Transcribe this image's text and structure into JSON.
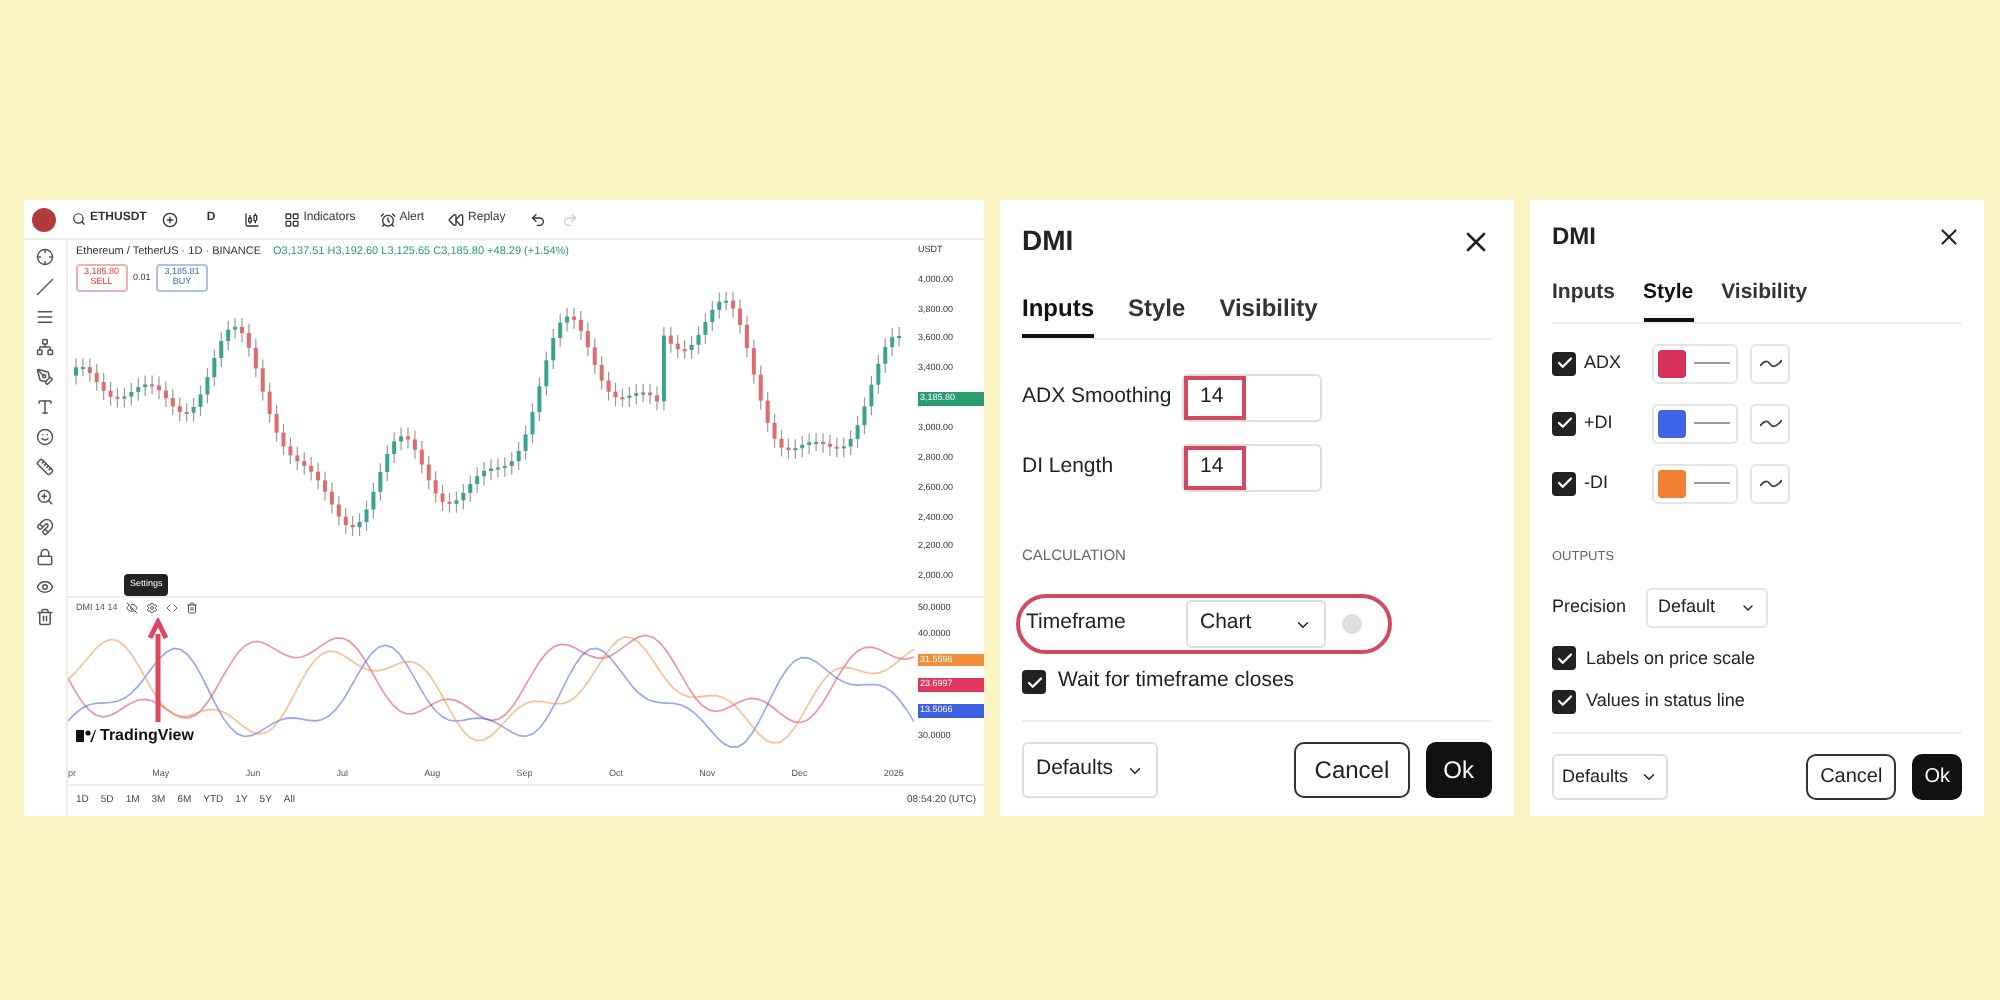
{
  "chart_window": {
    "toolbar": {
      "symbol": "ETHUSDT",
      "interval": "D",
      "items": [
        "Indicators",
        "Alert",
        "Replay"
      ]
    },
    "legend": {
      "title": "Ethereum / TetherUS · 1D · BINANCE",
      "ohlc": "O3,137.51 H3,192.60 L3,125.65 C3,185.80 +48.29 (+1.54%)"
    },
    "trade": {
      "sell_price": "3,185.80",
      "sell_label": "SELL",
      "spread": "0.01",
      "buy_price": "3,185.81",
      "buy_label": "BUY"
    },
    "currency": "USDT",
    "price_ticks": [
      "4,000.00",
      "3,800.00",
      "3,600.00",
      "3,400.00",
      "3,185.80",
      "3,000.00",
      "2,800.00",
      "2,600.00",
      "2,400.00",
      "2,200.00",
      "2,000.00"
    ],
    "indicator": {
      "label": "DMI 14 14",
      "tooltip": "Settings",
      "ticks": [
        "50.0000",
        "40.0000",
        "30.0000"
      ],
      "values": [
        {
          "text": "31.5596",
          "color": "#f28c38"
        },
        {
          "text": "23.6997",
          "color": "#e0365f"
        },
        {
          "text": "13.5066",
          "color": "#3e5fe0"
        }
      ]
    },
    "logo": "TradingView",
    "months": [
      "pr",
      "May",
      "Jun",
      "Jul",
      "Aug",
      "Sep",
      "Oct",
      "Nov",
      "Dec",
      "2025"
    ],
    "ranges": [
      "1D",
      "5D",
      "1M",
      "3M",
      "6M",
      "YTD",
      "1Y",
      "5Y",
      "All"
    ],
    "clock": "08:54:20 (UTC)"
  },
  "inputs_dialog": {
    "title": "DMI",
    "tabs": [
      {
        "label": "Inputs",
        "selected": true
      },
      {
        "label": "Style",
        "selected": false
      },
      {
        "label": "Visibility",
        "selected": false
      }
    ],
    "fields": [
      {
        "label": "ADX Smoothing",
        "value": "14",
        "highlighted": true
      },
      {
        "label": "DI Length",
        "value": "14",
        "highlighted": true
      }
    ],
    "section": "CALCULATION",
    "timeframe": {
      "label": "Timeframe",
      "value": "Chart",
      "highlighted": true
    },
    "wait": {
      "label": "Wait for timeframe closes",
      "checked": true
    },
    "defaults": "Defaults",
    "cancel": "Cancel",
    "ok": "Ok"
  },
  "style_dialog": {
    "title": "DMI",
    "tabs": [
      {
        "label": "Inputs",
        "selected": false
      },
      {
        "label": "Style",
        "selected": true
      },
      {
        "label": "Visibility",
        "selected": false
      }
    ],
    "plots": [
      {
        "label": "ADX",
        "checked": true,
        "color": "#d93159"
      },
      {
        "label": "+DI",
        "checked": true,
        "color": "#3d63e8"
      },
      {
        "label": "-DI",
        "checked": true,
        "color": "#ef7f32"
      }
    ],
    "section": "OUTPUTS",
    "precision": {
      "label": "Precision",
      "value": "Default"
    },
    "options": [
      {
        "label": "Labels on price scale",
        "checked": true
      },
      {
        "label": "Values in status line",
        "checked": true
      }
    ],
    "defaults": "Defaults",
    "cancel": "Cancel",
    "ok": "Ok"
  }
}
